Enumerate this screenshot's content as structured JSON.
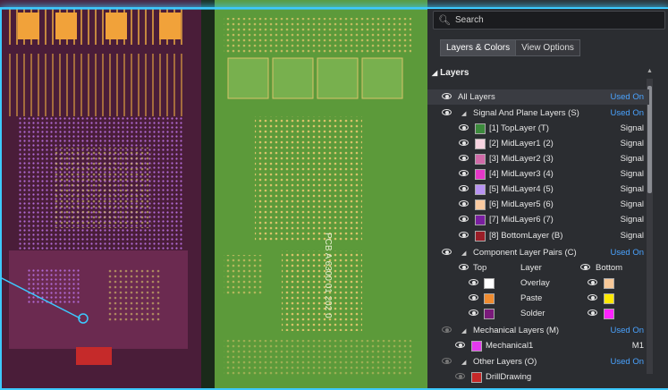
{
  "search": {
    "placeholder": "Search"
  },
  "tabs": [
    {
      "label": "Layers & Colors"
    },
    {
      "label": "View Options"
    }
  ],
  "section_title": "Layers",
  "all_layers": {
    "label": "All Layers",
    "status": "Used On"
  },
  "signal_group": {
    "label": "Signal And Plane Layers (S)",
    "status": "Used On"
  },
  "signal_layers": [
    {
      "label": "[1] TopLayer (T)",
      "type": "Signal",
      "color": "#3c8a3c"
    },
    {
      "label": "[2] MidLayer1 (2)",
      "type": "Signal",
      "color": "#f6d3e0"
    },
    {
      "label": "[3] MidLayer2 (3)",
      "type": "Signal",
      "color": "#d06aa8"
    },
    {
      "label": "[4] MidLayer3 (4)",
      "type": "Signal",
      "color": "#e438c8"
    },
    {
      "label": "[5] MidLayer4 (5)",
      "type": "Signal",
      "color": "#b893f2"
    },
    {
      "label": "[6] MidLayer5 (6)",
      "type": "Signal",
      "color": "#f8c9a0"
    },
    {
      "label": "[7] MidLayer6 (7)",
      "type": "Signal",
      "color": "#7a1fa0"
    },
    {
      "label": "[8] BottomLayer (B)",
      "type": "Signal",
      "color": "#9a1e28"
    }
  ],
  "component_group": {
    "label": "Component Layer Pairs (C)",
    "status": "Used On"
  },
  "component_header": {
    "top": "Top",
    "layer": "Layer",
    "bottom": "Bottom"
  },
  "component_pairs": [
    {
      "layer": "Overlay",
      "top_color": "#ffffff",
      "bottom_color": "#f7c898"
    },
    {
      "layer": "Paste",
      "top_color": "#f08c30",
      "bottom_color": "#ffe800"
    },
    {
      "layer": "Solder",
      "top_color": "#7a1a7a",
      "bottom_color": "#ff22ff"
    }
  ],
  "mechanical_group": {
    "label": "Mechanical Layers (M)",
    "status": "Used On"
  },
  "mechanical_layers": [
    {
      "label": "Mechanical1",
      "type": "M1",
      "color": "#e43aed"
    }
  ],
  "other_group": {
    "label": "Other Layers (O)",
    "status": "Used On"
  },
  "other_layers": [
    {
      "label": "DrillDrawing",
      "color": "#c62828"
    }
  ],
  "pcb": {
    "silk_text": "PCB A 6300 01 202 0"
  }
}
